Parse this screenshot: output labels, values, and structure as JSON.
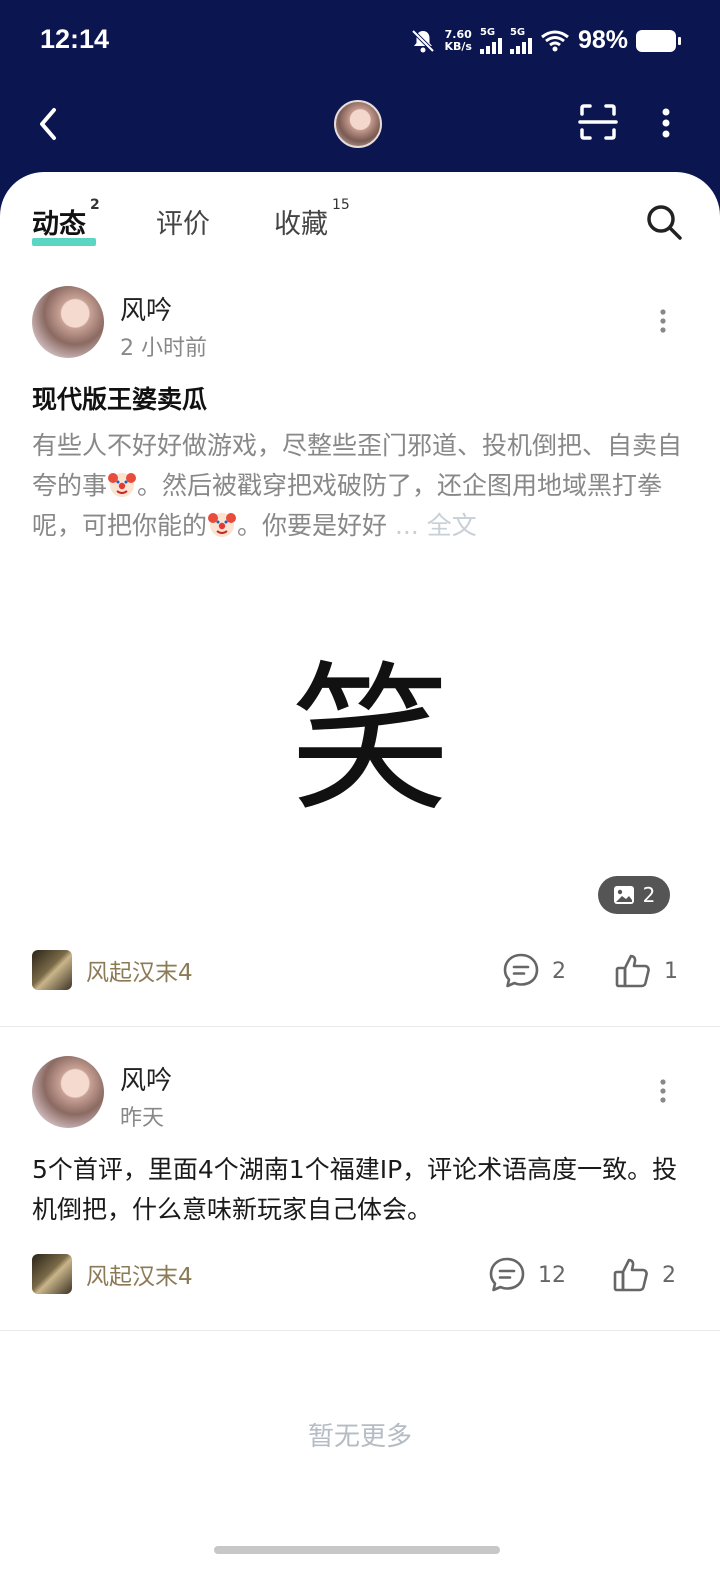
{
  "status_bar": {
    "time": "12:14",
    "net_speed_value": "7.60",
    "net_speed_unit": "KB/s",
    "signal1_label": "5G",
    "signal2_label": "5G",
    "battery_percent": "98%"
  },
  "colors": {
    "header_bg": "#0b1550",
    "tab_indicator": "#5cd6c4",
    "game_name": "#8b7a55"
  },
  "tabs": [
    {
      "label": "动态",
      "count": "2"
    },
    {
      "label": "评价",
      "count": ""
    },
    {
      "label": "收藏",
      "count": "15"
    }
  ],
  "posts": [
    {
      "author": "风吟",
      "time": "2 小时前",
      "title": "现代版王婆卖瓜",
      "body_part1": "有些人不好好做游戏，尽整些歪门邪道、投机倒把、自卖自夸的事",
      "body_part2": "。然后被戳穿把戏破防了，还企图用地域黑打拳呢，可把你能的",
      "body_part3": "。你要是好好",
      "more_label": "... 全文",
      "image_char": "笑",
      "image_count": "2",
      "game": "风起汉末4",
      "comments": "2",
      "likes": "1"
    },
    {
      "author": "风吟",
      "time": "昨天",
      "body": "5个首评，里面4个湖南1个福建IP，评论术语高度一致。投机倒把，什么意味新玩家自己体会。",
      "game": "风起汉末4",
      "comments": "12",
      "likes": "2"
    }
  ],
  "footer": {
    "no_more": "暂无更多"
  }
}
